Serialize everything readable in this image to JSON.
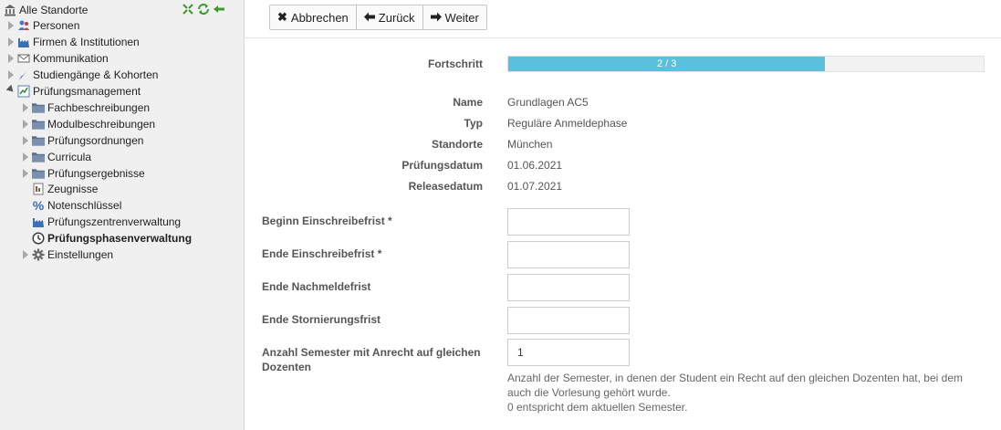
{
  "sidebar": {
    "root": {
      "label": "Alle Standorte",
      "icon": "building-icon"
    },
    "root_tools": [
      "expand-icon",
      "refresh-icon",
      "back-arrow-icon"
    ],
    "items": [
      {
        "label": "Personen",
        "icon": "people-icon"
      },
      {
        "label": "Firmen & Institutionen",
        "icon": "factory-icon"
      },
      {
        "label": "Kommunikation",
        "icon": "envelope-icon"
      },
      {
        "label": "Studiengänge & Kohorten",
        "icon": "feather-icon"
      },
      {
        "label": "Prüfungsmanagement",
        "icon": "chart-icon"
      },
      {
        "label": "Fachbeschreibungen",
        "icon": "folder-icon"
      },
      {
        "label": "Modulbeschreibungen",
        "icon": "folder-icon"
      },
      {
        "label": "Prüfungsordnungen",
        "icon": "folder-icon"
      },
      {
        "label": "Curricula",
        "icon": "folder-icon"
      },
      {
        "label": "Prüfungsergebnisse",
        "icon": "folder-icon"
      },
      {
        "label": "Zeugnisse",
        "icon": "certificate-icon"
      },
      {
        "label": "Notenschlüssel",
        "icon": "percent-icon"
      },
      {
        "label": "Prüfungszentrenverwaltung",
        "icon": "factory-icon"
      },
      {
        "label": "Prüfungsphasenverwaltung",
        "icon": "clock-icon"
      },
      {
        "label": "Einstellungen",
        "icon": "gear-icon"
      }
    ]
  },
  "toolbar": {
    "cancel_label": "Abbrechen",
    "back_label": "Zurück",
    "next_label": "Weiter"
  },
  "progress": {
    "label": "Fortschritt",
    "text": "2 / 3",
    "current": 2,
    "total": 3,
    "color": "#5bc0de"
  },
  "details": {
    "name_label": "Name",
    "name_value": "Grundlagen AC5",
    "type_label": "Typ",
    "type_value": "Reguläre Anmeldephase",
    "locations_label": "Standorte",
    "locations_value": "München",
    "exam_date_label": "Prüfungsdatum",
    "exam_date_value": "01.06.2021",
    "release_date_label": "Releasedatum",
    "release_date_value": "01.07.2021"
  },
  "form": {
    "start_label": "Beginn Einschreibefrist *",
    "start_value": "",
    "end_label": "Ende Einschreibefrist *",
    "end_value": "",
    "late_label": "Ende Nachmeldefrist",
    "late_value": "",
    "cancel_label": "Ende Stornierungsfrist",
    "cancel_value": "",
    "semesters_label_line1": "Anzahl Semester mit Anrecht auf gleichen",
    "semesters_label_line2": "Dozenten",
    "semesters_value": "1",
    "help_line1": "Anzahl der Semester, in denen der Student ein Recht auf den gleichen Dozenten hat, bei dem",
    "help_line2": "auch die Vorlesung gehört wurde.",
    "help_line3": "0 entspricht dem aktuellen Semester."
  }
}
